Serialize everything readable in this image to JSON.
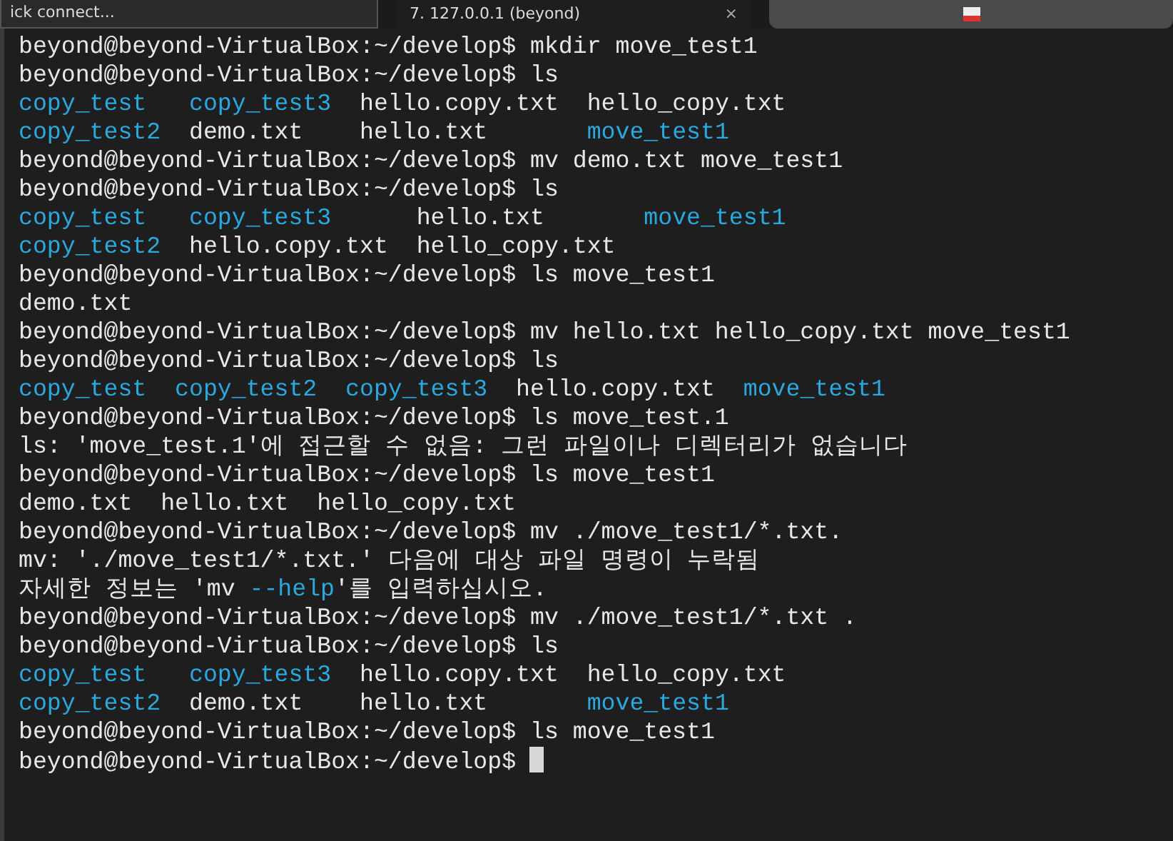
{
  "tab_strip": {
    "quick_connect": "ick connect...",
    "tabs": [
      {
        "title": "7. 127.0.0.1 (beyond)",
        "selected": true,
        "close": "×"
      },
      {
        "selected": false
      }
    ]
  },
  "terminal": {
    "lines": [
      {
        "kind": "command",
        "prompt": "beyond@beyond-VirtualBox:~/develop$",
        "command": "mkdir move_test1",
        "cursor": false
      },
      {
        "kind": "command",
        "prompt": "beyond@beyond-VirtualBox:~/develop$",
        "command": "ls",
        "cursor": false
      },
      {
        "kind": "listing",
        "columns": [
          [
            {
              "name": "copy_test",
              "kind": "dir"
            },
            {
              "name": "copy_test2",
              "kind": "dir"
            }
          ],
          [
            {
              "name": "copy_test3",
              "kind": "dir"
            },
            {
              "name": "demo.txt",
              "kind": "file"
            }
          ],
          [
            {
              "name": "hello.copy.txt",
              "kind": "file"
            },
            {
              "name": "hello.txt",
              "kind": "file"
            }
          ],
          [
            {
              "name": "hello_copy.txt",
              "kind": "file"
            },
            {
              "name": "move_test1",
              "kind": "dir"
            }
          ]
        ]
      },
      {
        "kind": "command",
        "prompt": "beyond@beyond-VirtualBox:~/develop$",
        "command": "mv demo.txt move_test1",
        "cursor": false
      },
      {
        "kind": "command",
        "prompt": "beyond@beyond-VirtualBox:~/develop$",
        "command": "ls",
        "cursor": false
      },
      {
        "kind": "listing",
        "columns": [
          [
            {
              "name": "copy_test",
              "kind": "dir"
            },
            {
              "name": "copy_test2",
              "kind": "dir"
            }
          ],
          [
            {
              "name": "copy_test3",
              "kind": "dir"
            },
            {
              "name": "hello.copy.txt",
              "kind": "file"
            }
          ],
          [
            {
              "name": "hello.txt",
              "kind": "file"
            },
            {
              "name": "hello_copy.txt",
              "kind": "file"
            }
          ],
          [
            {
              "name": "move_test1",
              "kind": "dir"
            }
          ]
        ]
      },
      {
        "kind": "command",
        "prompt": "beyond@beyond-VirtualBox:~/develop$",
        "command": "ls move_test1",
        "cursor": false
      },
      {
        "kind": "listing",
        "columns": [
          [
            {
              "name": "demo.txt",
              "kind": "file"
            }
          ]
        ]
      },
      {
        "kind": "command",
        "prompt": "beyond@beyond-VirtualBox:~/develop$",
        "command": "mv hello.txt hello_copy.txt move_test1",
        "cursor": false
      },
      {
        "kind": "command",
        "prompt": "beyond@beyond-VirtualBox:~/develop$",
        "command": "ls",
        "cursor": false
      },
      {
        "kind": "listing",
        "columns": [
          [
            {
              "name": "copy_test",
              "kind": "dir"
            }
          ],
          [
            {
              "name": "copy_test2",
              "kind": "dir"
            }
          ],
          [
            {
              "name": "copy_test3",
              "kind": "dir"
            }
          ],
          [
            {
              "name": "hello.copy.txt",
              "kind": "file"
            }
          ],
          [
            {
              "name": "move_test1",
              "kind": "dir"
            }
          ]
        ]
      },
      {
        "kind": "command",
        "prompt": "beyond@beyond-VirtualBox:~/develop$",
        "command": "ls move_test.1",
        "cursor": false
      },
      {
        "kind": "text",
        "segments": [
          {
            "text": "ls: 'move_test.1'에 접근할 수 없음: 그런 파일이나 디렉터리가 없습니다",
            "kind": "plain"
          }
        ]
      },
      {
        "kind": "command",
        "prompt": "beyond@beyond-VirtualBox:~/develop$",
        "command": "ls move_test1",
        "cursor": false
      },
      {
        "kind": "listing",
        "columns": [
          [
            {
              "name": "demo.txt",
              "kind": "file"
            }
          ],
          [
            {
              "name": "hello.txt",
              "kind": "file"
            }
          ],
          [
            {
              "name": "hello_copy.txt",
              "kind": "file"
            }
          ]
        ]
      },
      {
        "kind": "command",
        "prompt": "beyond@beyond-VirtualBox:~/develop$",
        "command": "mv ./move_test1/*.txt.",
        "cursor": false
      },
      {
        "kind": "text",
        "segments": [
          {
            "text": "mv: './move_test1/*.txt.' 다음에 대상 파일 명령이 누락됨",
            "kind": "plain"
          }
        ]
      },
      {
        "kind": "text",
        "segments": [
          {
            "text": "자세한 정보는 'mv ",
            "kind": "plain"
          },
          {
            "text": "--help",
            "kind": "highlight"
          },
          {
            "text": "'를 입력하십시오.",
            "kind": "plain"
          }
        ]
      },
      {
        "kind": "command",
        "prompt": "beyond@beyond-VirtualBox:~/develop$",
        "command": "mv ./move_test1/*.txt .",
        "cursor": false
      },
      {
        "kind": "command",
        "prompt": "beyond@beyond-VirtualBox:~/develop$",
        "command": "ls",
        "cursor": false
      },
      {
        "kind": "listing",
        "columns": [
          [
            {
              "name": "copy_test",
              "kind": "dir"
            },
            {
              "name": "copy_test2",
              "kind": "dir"
            }
          ],
          [
            {
              "name": "copy_test3",
              "kind": "dir"
            },
            {
              "name": "demo.txt",
              "kind": "file"
            }
          ],
          [
            {
              "name": "hello.copy.txt",
              "kind": "file"
            },
            {
              "name": "hello.txt",
              "kind": "file"
            }
          ],
          [
            {
              "name": "hello_copy.txt",
              "kind": "file"
            },
            {
              "name": "move_test1",
              "kind": "dir"
            }
          ]
        ]
      },
      {
        "kind": "command",
        "prompt": "beyond@beyond-VirtualBox:~/develop$",
        "command": "ls move_test1",
        "cursor": false
      },
      {
        "kind": "command",
        "prompt": "beyond@beyond-VirtualBox:~/develop$",
        "cursor": true
      }
    ]
  }
}
